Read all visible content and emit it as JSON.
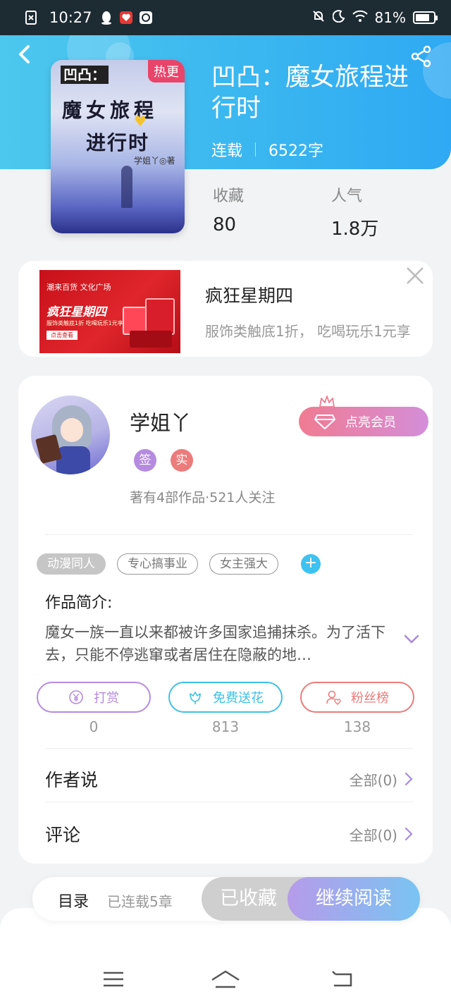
{
  "status": {
    "time": "10:27",
    "battery_text": "81%",
    "battery_level": 0.81
  },
  "book": {
    "cover_line1": "凹凸：",
    "cover_line2": "魔女旅程",
    "cover_line3": "进行时",
    "cover_author": "学姐丫◎著",
    "hot_badge": "热更",
    "title": "凹凸：魔女旅程进行时",
    "status": "连载",
    "word_count": "6522字",
    "favorites_label": "收藏",
    "favorites_value": "80",
    "popularity_label": "人气",
    "popularity_value": "1.8万"
  },
  "ad": {
    "image_logo": "潮来百货 文化广场",
    "image_headline": "疯狂星期四",
    "image_sub": "服饰类触底1折 吃喝玩乐1元享",
    "image_button": "点击查看",
    "title": "疯狂星期四",
    "desc": "服饰类触底1折， 吃喝玩乐1元享"
  },
  "author": {
    "name": "学姐丫",
    "badge_sign": "签",
    "badge_real": "实",
    "follow_info": "著有4部作品·521人关注",
    "vip_label": "点亮会员"
  },
  "tags": [
    "动漫同人",
    "专心搞事业",
    "女主强大"
  ],
  "intro": {
    "heading": "作品简介:",
    "text": "魔女一族一直以来都被许多国家追捕抹杀。为了活下去，只能不停逃窜或者居住在隐蔽的地…"
  },
  "actions": [
    {
      "label": "打赏",
      "count": "0",
      "color": "#b58be0"
    },
    {
      "label": "免费送花",
      "count": "813",
      "color": "#3ec2e6"
    },
    {
      "label": "粉丝榜",
      "count": "138",
      "color": "#ec7b7b"
    }
  ],
  "rows": {
    "author_says": "作者说",
    "author_says_all": "全部(0)",
    "comments": "评论",
    "comments_all": "全部(0)"
  },
  "bottom": {
    "toc": "目录",
    "toc_sub": "已连载5章",
    "collected": "已收藏",
    "continue": "继续阅读"
  },
  "colors": {
    "accent": "#39b5f0",
    "hot": "#e9446a"
  }
}
